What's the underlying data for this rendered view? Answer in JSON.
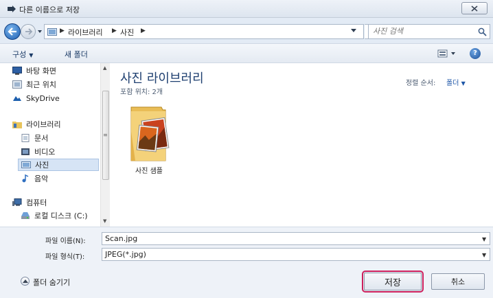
{
  "window": {
    "title": "다른 이름으로 저장",
    "title_icon": "save-arrow-icon",
    "close_icon": "close-icon"
  },
  "address": {
    "crumbs": [
      "라이브러리",
      "사진"
    ],
    "search_placeholder": "사진 검색"
  },
  "toolbar": {
    "organize_label": "구성",
    "new_folder_label": "새 폴더"
  },
  "nav": {
    "items": [
      {
        "label": "바탕 화면",
        "icon": "desktop-icon"
      },
      {
        "label": "최근 위치",
        "icon": "recent-places-icon"
      },
      {
        "label": "SkyDrive",
        "icon": "skydrive-icon"
      },
      {
        "label": "라이브러리",
        "icon": "library-icon"
      },
      {
        "label": "문서",
        "icon": "documents-icon"
      },
      {
        "label": "비디오",
        "icon": "video-icon"
      },
      {
        "label": "사진",
        "icon": "pictures-icon",
        "selected": true
      },
      {
        "label": "음악",
        "icon": "music-icon"
      },
      {
        "label": "컴퓨터",
        "icon": "computer-icon"
      },
      {
        "label": "로컬 디스크 (C:)",
        "icon": "disk-icon"
      }
    ]
  },
  "content": {
    "title": "사진 라이브러리",
    "subtitle": "포함 위치: 2개",
    "sort_label": "정렬 순서:",
    "sort_value": "폴더",
    "folders": [
      {
        "name": "사진 샘플",
        "icon": "sample-pictures-folder-icon"
      }
    ]
  },
  "form": {
    "filename_label": "파일 이름(N):",
    "filename_value": "Scan.jpg",
    "filetype_label": "파일 형식(T):",
    "filetype_value": "JPEG(*.jpg)"
  },
  "bottom": {
    "hide_folders_label": "폴더 숨기기",
    "save_label": "저장",
    "cancel_label": "취소"
  },
  "colors": {
    "accent": "#1e3f70",
    "link": "#1f57a8",
    "save_highlight": "#cc1f5c",
    "selection": "#d6e4f5"
  }
}
